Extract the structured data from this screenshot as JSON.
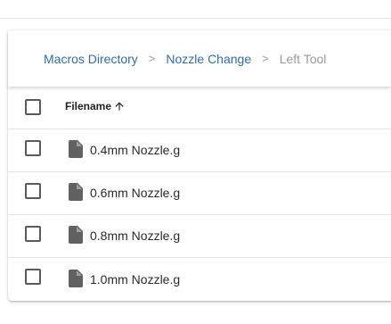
{
  "breadcrumb": {
    "items": [
      {
        "label": "Macros Directory"
      },
      {
        "label": "Nozzle Change"
      },
      {
        "label": "Left Tool"
      }
    ],
    "separator": ">"
  },
  "table": {
    "header": {
      "filename_label": "Filename",
      "sort_icon": "arrow-up-icon"
    },
    "rows": [
      {
        "name": "0.4mm Nozzle.g",
        "icon": "file-icon"
      },
      {
        "name": "0.6mm Nozzle.g",
        "icon": "file-icon"
      },
      {
        "name": "0.8mm Nozzle.g",
        "icon": "file-icon"
      },
      {
        "name": "1.0mm Nozzle.g",
        "icon": "file-icon"
      }
    ]
  },
  "colors": {
    "link": "#2f6fa7",
    "muted": "#9a9a9a",
    "icon": "#616161"
  }
}
